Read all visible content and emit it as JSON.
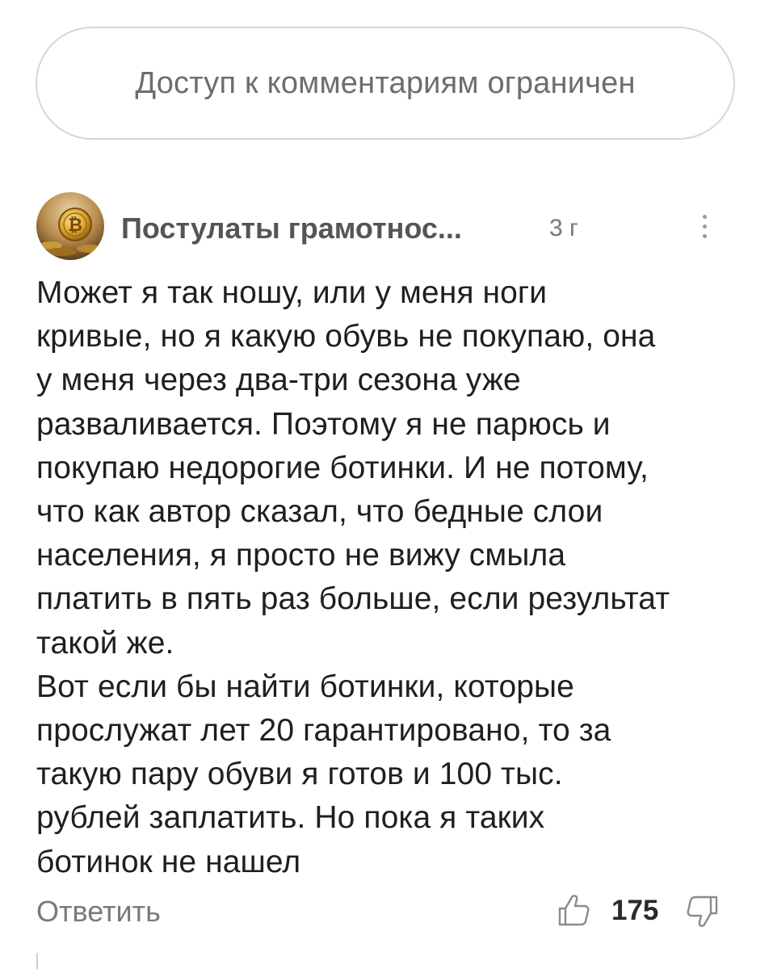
{
  "banner": {
    "text": "Доступ к комментариям ограничен"
  },
  "comment": {
    "author": "Постулаты грамотнос...",
    "age": "3 г",
    "text": "Может я так ношу, или у меня ноги\nкривые, но я какую обувь не покупаю, она\nу меня через два-три сезона уже\nразваливается. Поэтому я не парюсь и\nпокупаю недорогие ботинки. И не потому,\nчто как автор сказал, что бедные слои\nнаселения, я просто не вижу смыла\nплатить в пять раз больше, если результат\nтакой же.\nВот если бы найти ботинки, которые\nпрослужат лет 20 гарантировано, то за\nтакую пару обуви я готов и 100 тыс.\nрублей заплатить. Но пока я таких\nботинок не нашел",
    "reply_label": "Ответить",
    "likes": "175",
    "icons": {
      "avatar": "avatar-bitcoin-coin",
      "more": "more-vertical-icon",
      "like": "thumbs-up-icon",
      "dislike": "thumbs-down-icon"
    }
  }
}
